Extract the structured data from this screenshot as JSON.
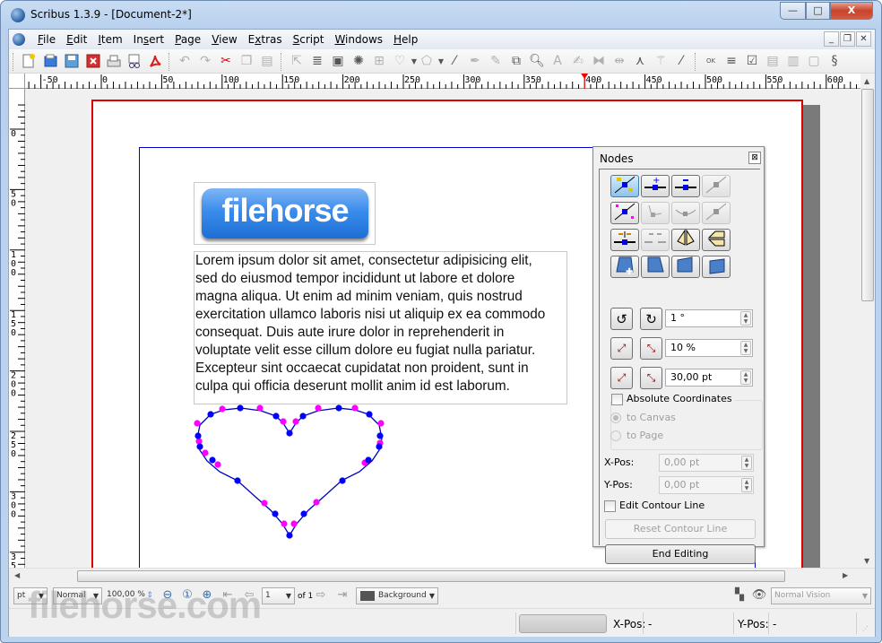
{
  "window": {
    "title": "Scribus 1.3.9 - [Document-2*]",
    "controls": {
      "minimize": "—",
      "maximize": "□",
      "close": "X"
    }
  },
  "menubar": {
    "items": [
      {
        "label": "File",
        "accel": "F"
      },
      {
        "label": "Edit",
        "accel": "E"
      },
      {
        "label": "Item",
        "accel": "I"
      },
      {
        "label": "Insert",
        "accel": "s"
      },
      {
        "label": "Page",
        "accel": "P"
      },
      {
        "label": "View",
        "accel": "V"
      },
      {
        "label": "Extras",
        "accel": "x"
      },
      {
        "label": "Script",
        "accel": "S"
      },
      {
        "label": "Windows",
        "accel": "W"
      },
      {
        "label": "Help",
        "accel": "H"
      }
    ],
    "mdi": {
      "minimize": "_",
      "restore": "❐",
      "close": "✕"
    }
  },
  "toolbar": {
    "file_tools": [
      "new-document",
      "open-document",
      "save-document",
      "close-document",
      "print",
      "preflight-verifier",
      "export-pdf"
    ],
    "edit_tools": [
      "undo",
      "redo",
      "cut",
      "copy",
      "paste"
    ],
    "item_tools": [
      "select-item",
      "insert-text-frame",
      "insert-image-frame",
      "insert-render-frame",
      "insert-table",
      "insert-shape",
      "insert-polygon",
      "insert-line",
      "insert-bezier",
      "insert-freehand-line",
      "rotate-item",
      "zoom",
      "edit-contents",
      "edit-text",
      "link-text-frames",
      "unlink-text-frames",
      "measurements",
      "copy-item-properties",
      "eye-dropper"
    ],
    "pdf_tools": [
      "pdf-push-button",
      "pdf-text-field",
      "pdf-check-box",
      "pdf-combo-box",
      "pdf-list-box",
      "text-annotation",
      "link-annotation"
    ]
  },
  "rulers": {
    "horizontal": [
      "-50",
      "0",
      "50",
      "100",
      "150",
      "200",
      "250",
      "300",
      "350",
      "400",
      "450",
      "500",
      "550",
      "600"
    ],
    "vertical": [
      "0",
      "50",
      "100",
      "150",
      "200",
      "250",
      "300",
      "350"
    ],
    "marker_value": "400"
  },
  "document": {
    "logo_text": "filehorse",
    "body_text": "Lorem ipsum dolor sit amet, consectetur adipisicing elit,\nsed do eiusmod tempor incididunt ut labore et dolore\nmagna aliqua. Ut enim ad minim veniam, quis nostrud\nexercitation ullamco laboris nisi ut aliquip ex ea commodo\nconsequat. Duis aute irure dolor in reprehenderit in\nvoluptate velit esse cillum dolore eu fugiat nulla pariatur.\nExcepteur sint occaecat cupidatat non proident, sunt in\nculpa qui officia deserunt mollit anim id est laborum.",
    "shape": "heart",
    "colors": {
      "page_border": "#e00000",
      "margin_guide": "#0000c8",
      "node": "#0000ff",
      "control_point": "#ff00ff"
    }
  },
  "nodes_panel": {
    "title": "Nodes",
    "close": "⊠",
    "node_buttons": [
      [
        "move-nodes",
        "add-nodes",
        "delete-nodes",
        "reset-control-points"
      ],
      [
        "move-control-points",
        "independent-control-points",
        "symmetric-control-points",
        "reset-this-control-point"
      ],
      [
        "open-path",
        "close-path",
        "mirror-horizontal",
        "mirror-vertical"
      ],
      [
        "shear-left",
        "shear-right",
        "shear-up",
        "shear-down"
      ]
    ],
    "rotate_value": "1 °",
    "scale_percent_value": "10 %",
    "scale_pt_value": "30,00 pt",
    "absolute_coordinates_label": "Absolute Coordinates",
    "to_canvas_label": "to Canvas",
    "to_page_label": "to Page",
    "xpos_label": "X-Pos:",
    "xpos_value": "0,00 pt",
    "ypos_label": "Y-Pos:",
    "ypos_value": "0,00 pt",
    "edit_contour_label": "Edit Contour Line",
    "reset_contour_label": "Reset Contour Line",
    "end_editing_label": "End Editing"
  },
  "bottombar": {
    "unit": "pt",
    "image_quality": "Normal",
    "zoom": "100,00 %",
    "page": "1",
    "of_pages": "of 1",
    "layer": "Background",
    "vision": "Normal Vision"
  },
  "statusbar": {
    "xpos_label": "X-Pos:",
    "xpos_value": "-",
    "ypos_label": "Y-Pos:",
    "ypos_value": "-"
  },
  "watermark": "filehorse.com"
}
